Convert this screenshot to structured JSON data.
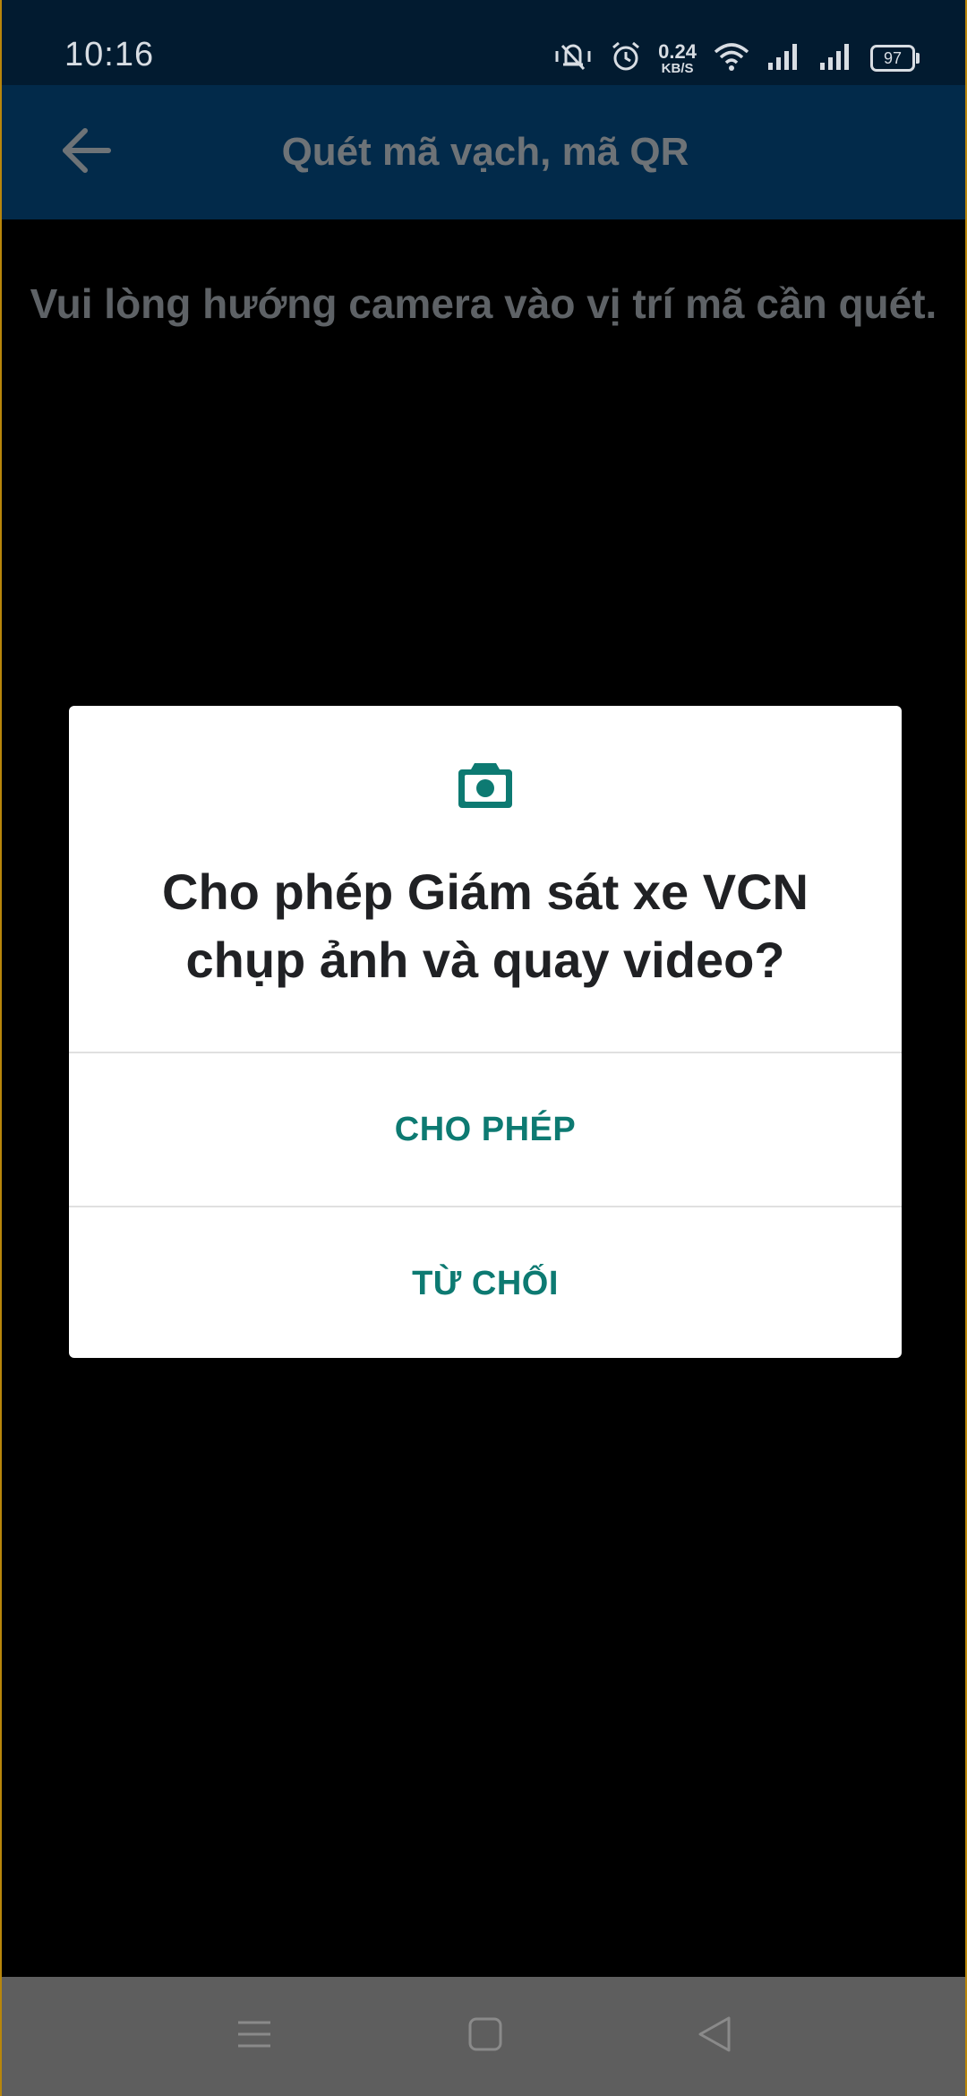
{
  "status_bar": {
    "time": "10:16",
    "net_speed_value": "0.24",
    "net_speed_unit": "KB/S",
    "battery": "97",
    "icons": [
      "vibrate-silent-icon",
      "alarm-icon",
      "wifi-icon",
      "signal-icon",
      "signal-icon",
      "battery-icon"
    ]
  },
  "app_bar": {
    "title": "Quét mã vạch, mã QR",
    "back_icon": "back-arrow-icon"
  },
  "main": {
    "instruction": "Vui lòng hướng camera vào vị trí mã cần quét."
  },
  "permission_dialog": {
    "icon": "camera-icon",
    "title_line1": "Cho phép Giám sát xe VCN",
    "title_line2": "chụp ảnh và quay video?",
    "allow_label": "CHO PHÉP",
    "deny_label": "TỪ CHỐI",
    "accent_color": "#0d7a72"
  },
  "nav_bar": {
    "items": [
      "menu-icon",
      "home-icon",
      "back-icon"
    ]
  },
  "colors": {
    "status_bar_bg": "#021b30",
    "app_bar_bg": "#022a4a",
    "screen_bg": "#000000",
    "nav_bar_bg": "#5e5e5e"
  }
}
